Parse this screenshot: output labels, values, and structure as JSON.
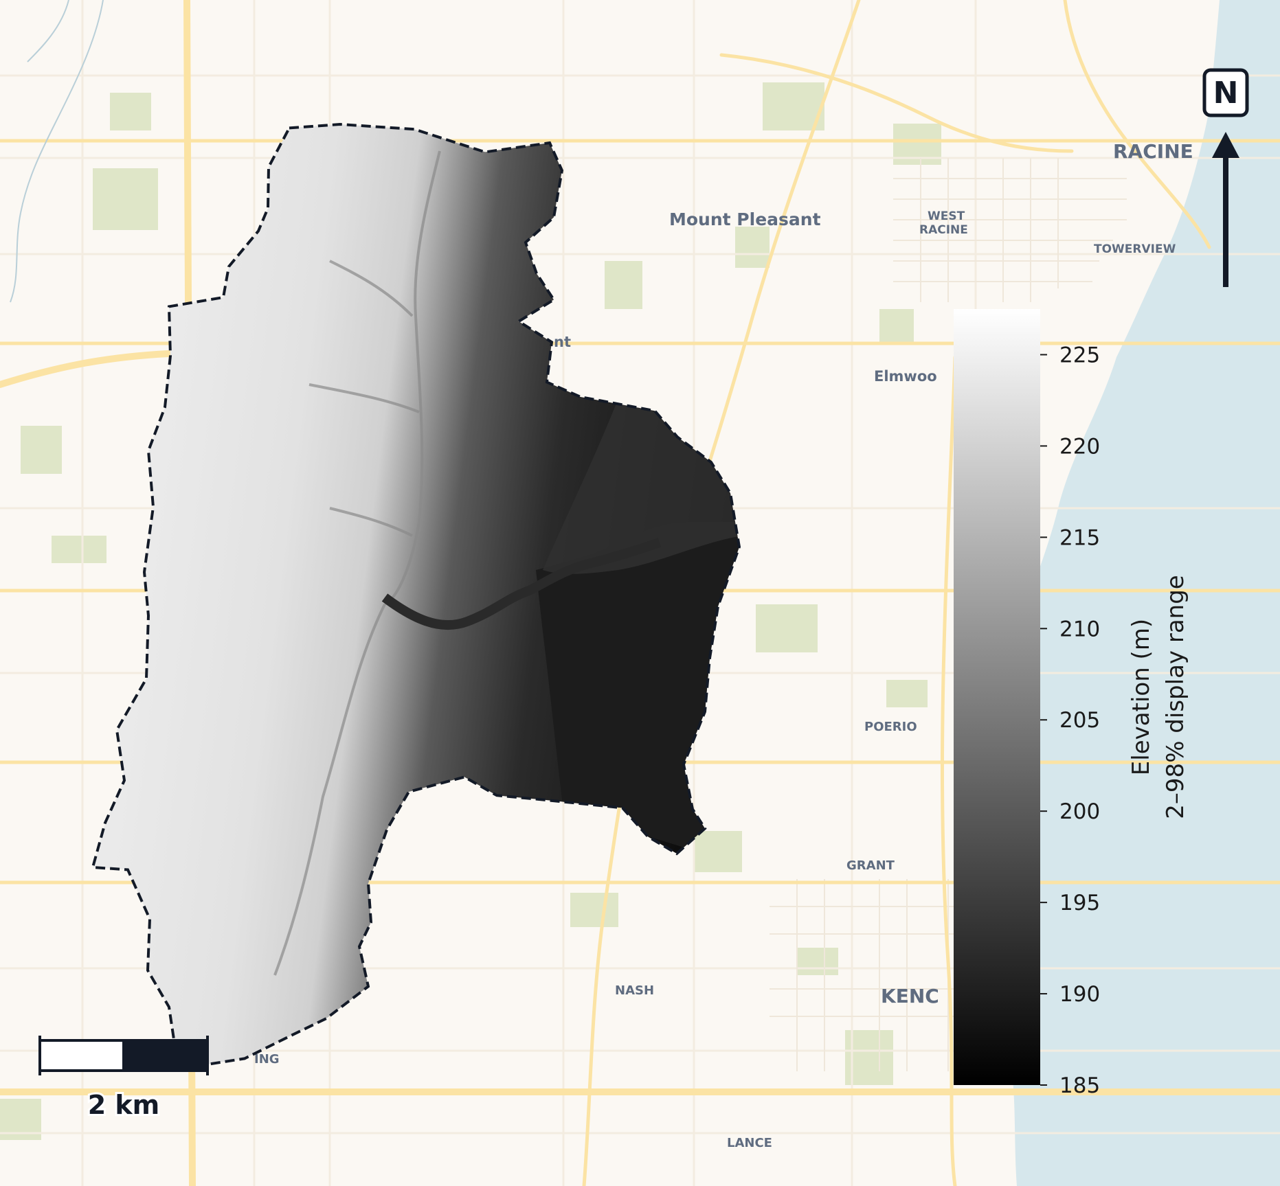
{
  "place_labels": [
    {
      "id": "racine",
      "text": "RACINE"
    },
    {
      "id": "mount-pleasant",
      "text": "Mount Pleasant"
    },
    {
      "id": "west-racine-1",
      "text": "WEST"
    },
    {
      "id": "west-racine-2",
      "text": "RACINE"
    },
    {
      "id": "towerview",
      "text": "TOWERVIEW"
    },
    {
      "id": "elmwood",
      "text": "Elmwoo"
    },
    {
      "id": "nt",
      "text": "nt"
    },
    {
      "id": "poerio",
      "text": "POERIO"
    },
    {
      "id": "grant",
      "text": "GRANT"
    },
    {
      "id": "nash",
      "text": "NASH"
    },
    {
      "id": "kenosha",
      "text": "KENC"
    },
    {
      "id": "lance",
      "text": "LANCE"
    },
    {
      "id": "ing",
      "text": "ING"
    }
  ],
  "north_arrow": {
    "label": "N"
  },
  "scale_bar": {
    "label": "2 km",
    "distance_km": 2
  },
  "colorbar": {
    "title_line1": "Elevation (m)",
    "title_line2": "2–98% display range",
    "min": 185,
    "max": 227.5,
    "ticks": [
      185,
      190,
      195,
      200,
      205,
      210,
      215,
      220,
      225
    ],
    "tick_labels": [
      "185",
      "190",
      "195",
      "200",
      "205",
      "210",
      "215",
      "220",
      "225"
    ],
    "colormap": "grayscale (black to white)"
  },
  "colors": {
    "basemap_land": "#fbf8f3",
    "water": "#d6e7ec",
    "major_roads": "#fbe3a4",
    "minor_roads": "#f4eee2",
    "parks": "#dfe6c8",
    "boundary": "#131a27",
    "arrow": "#131a27"
  }
}
